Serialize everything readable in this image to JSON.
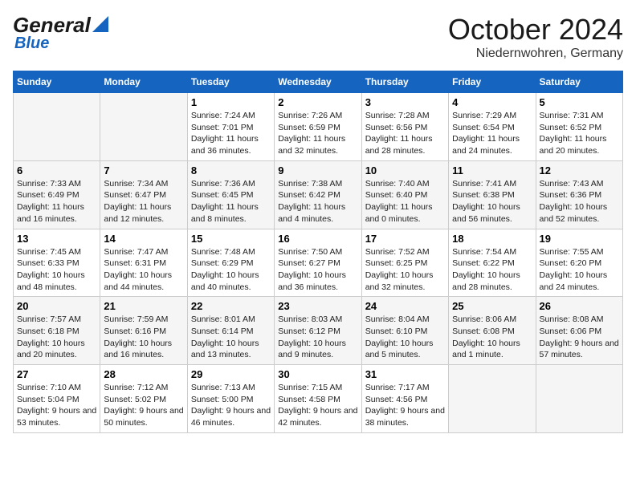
{
  "header": {
    "logo_general": "General",
    "logo_blue": "Blue",
    "month": "October 2024",
    "location": "Niedernwohren, Germany"
  },
  "days_of_week": [
    "Sunday",
    "Monday",
    "Tuesday",
    "Wednesday",
    "Thursday",
    "Friday",
    "Saturday"
  ],
  "weeks": [
    [
      {
        "day": "",
        "empty": true
      },
      {
        "day": "",
        "empty": true
      },
      {
        "day": "1",
        "sunrise": "7:24 AM",
        "sunset": "7:01 PM",
        "daylight": "11 hours and 36 minutes."
      },
      {
        "day": "2",
        "sunrise": "7:26 AM",
        "sunset": "6:59 PM",
        "daylight": "11 hours and 32 minutes."
      },
      {
        "day": "3",
        "sunrise": "7:28 AM",
        "sunset": "6:56 PM",
        "daylight": "11 hours and 28 minutes."
      },
      {
        "day": "4",
        "sunrise": "7:29 AM",
        "sunset": "6:54 PM",
        "daylight": "11 hours and 24 minutes."
      },
      {
        "day": "5",
        "sunrise": "7:31 AM",
        "sunset": "6:52 PM",
        "daylight": "11 hours and 20 minutes."
      }
    ],
    [
      {
        "day": "6",
        "sunrise": "7:33 AM",
        "sunset": "6:49 PM",
        "daylight": "11 hours and 16 minutes."
      },
      {
        "day": "7",
        "sunrise": "7:34 AM",
        "sunset": "6:47 PM",
        "daylight": "11 hours and 12 minutes."
      },
      {
        "day": "8",
        "sunrise": "7:36 AM",
        "sunset": "6:45 PM",
        "daylight": "11 hours and 8 minutes."
      },
      {
        "day": "9",
        "sunrise": "7:38 AM",
        "sunset": "6:42 PM",
        "daylight": "11 hours and 4 minutes."
      },
      {
        "day": "10",
        "sunrise": "7:40 AM",
        "sunset": "6:40 PM",
        "daylight": "11 hours and 0 minutes."
      },
      {
        "day": "11",
        "sunrise": "7:41 AM",
        "sunset": "6:38 PM",
        "daylight": "10 hours and 56 minutes."
      },
      {
        "day": "12",
        "sunrise": "7:43 AM",
        "sunset": "6:36 PM",
        "daylight": "10 hours and 52 minutes."
      }
    ],
    [
      {
        "day": "13",
        "sunrise": "7:45 AM",
        "sunset": "6:33 PM",
        "daylight": "10 hours and 48 minutes."
      },
      {
        "day": "14",
        "sunrise": "7:47 AM",
        "sunset": "6:31 PM",
        "daylight": "10 hours and 44 minutes."
      },
      {
        "day": "15",
        "sunrise": "7:48 AM",
        "sunset": "6:29 PM",
        "daylight": "10 hours and 40 minutes."
      },
      {
        "day": "16",
        "sunrise": "7:50 AM",
        "sunset": "6:27 PM",
        "daylight": "10 hours and 36 minutes."
      },
      {
        "day": "17",
        "sunrise": "7:52 AM",
        "sunset": "6:25 PM",
        "daylight": "10 hours and 32 minutes."
      },
      {
        "day": "18",
        "sunrise": "7:54 AM",
        "sunset": "6:22 PM",
        "daylight": "10 hours and 28 minutes."
      },
      {
        "day": "19",
        "sunrise": "7:55 AM",
        "sunset": "6:20 PM",
        "daylight": "10 hours and 24 minutes."
      }
    ],
    [
      {
        "day": "20",
        "sunrise": "7:57 AM",
        "sunset": "6:18 PM",
        "daylight": "10 hours and 20 minutes."
      },
      {
        "day": "21",
        "sunrise": "7:59 AM",
        "sunset": "6:16 PM",
        "daylight": "10 hours and 16 minutes."
      },
      {
        "day": "22",
        "sunrise": "8:01 AM",
        "sunset": "6:14 PM",
        "daylight": "10 hours and 13 minutes."
      },
      {
        "day": "23",
        "sunrise": "8:03 AM",
        "sunset": "6:12 PM",
        "daylight": "10 hours and 9 minutes."
      },
      {
        "day": "24",
        "sunrise": "8:04 AM",
        "sunset": "6:10 PM",
        "daylight": "10 hours and 5 minutes."
      },
      {
        "day": "25",
        "sunrise": "8:06 AM",
        "sunset": "6:08 PM",
        "daylight": "10 hours and 1 minute."
      },
      {
        "day": "26",
        "sunrise": "8:08 AM",
        "sunset": "6:06 PM",
        "daylight": "9 hours and 57 minutes."
      }
    ],
    [
      {
        "day": "27",
        "sunrise": "7:10 AM",
        "sunset": "5:04 PM",
        "daylight": "9 hours and 53 minutes."
      },
      {
        "day": "28",
        "sunrise": "7:12 AM",
        "sunset": "5:02 PM",
        "daylight": "9 hours and 50 minutes."
      },
      {
        "day": "29",
        "sunrise": "7:13 AM",
        "sunset": "5:00 PM",
        "daylight": "9 hours and 46 minutes."
      },
      {
        "day": "30",
        "sunrise": "7:15 AM",
        "sunset": "4:58 PM",
        "daylight": "9 hours and 42 minutes."
      },
      {
        "day": "31",
        "sunrise": "7:17 AM",
        "sunset": "4:56 PM",
        "daylight": "9 hours and 38 minutes."
      },
      {
        "day": "",
        "empty": true
      },
      {
        "day": "",
        "empty": true
      }
    ]
  ],
  "labels": {
    "sunrise": "Sunrise:",
    "sunset": "Sunset:",
    "daylight": "Daylight:"
  }
}
